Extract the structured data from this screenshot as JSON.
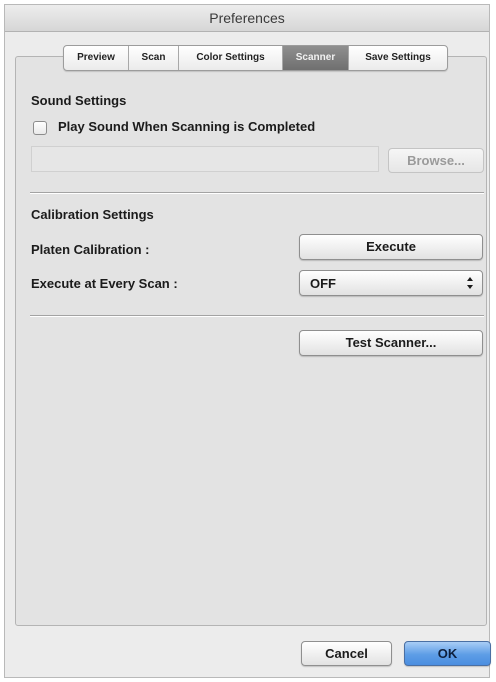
{
  "window": {
    "title": "Preferences"
  },
  "tabs": [
    {
      "label": "Preview",
      "selected": false
    },
    {
      "label": "Scan",
      "selected": false
    },
    {
      "label": "Color Settings",
      "selected": false
    },
    {
      "label": "Scanner",
      "selected": true
    },
    {
      "label": "Save Settings",
      "selected": false
    }
  ],
  "sound": {
    "heading": "Sound Settings",
    "play_sound_label": "Play Sound When Scanning is Completed",
    "play_sound_checked": false,
    "sound_file_value": "",
    "browse_label": "Browse..."
  },
  "calibration": {
    "heading": "Calibration Settings",
    "platen_label": "Platen Calibration :",
    "execute_label": "Execute",
    "every_scan_label": "Execute at Every Scan :",
    "every_scan_value": "OFF"
  },
  "test_scanner_label": "Test Scanner...",
  "footer": {
    "cancel_label": "Cancel",
    "ok_label": "OK"
  },
  "colors": {
    "window_bg": "#ececec",
    "panel_bg": "#e3e3e3",
    "selected_tab": "#7f7f7f",
    "default_button": "#5d9de6"
  }
}
